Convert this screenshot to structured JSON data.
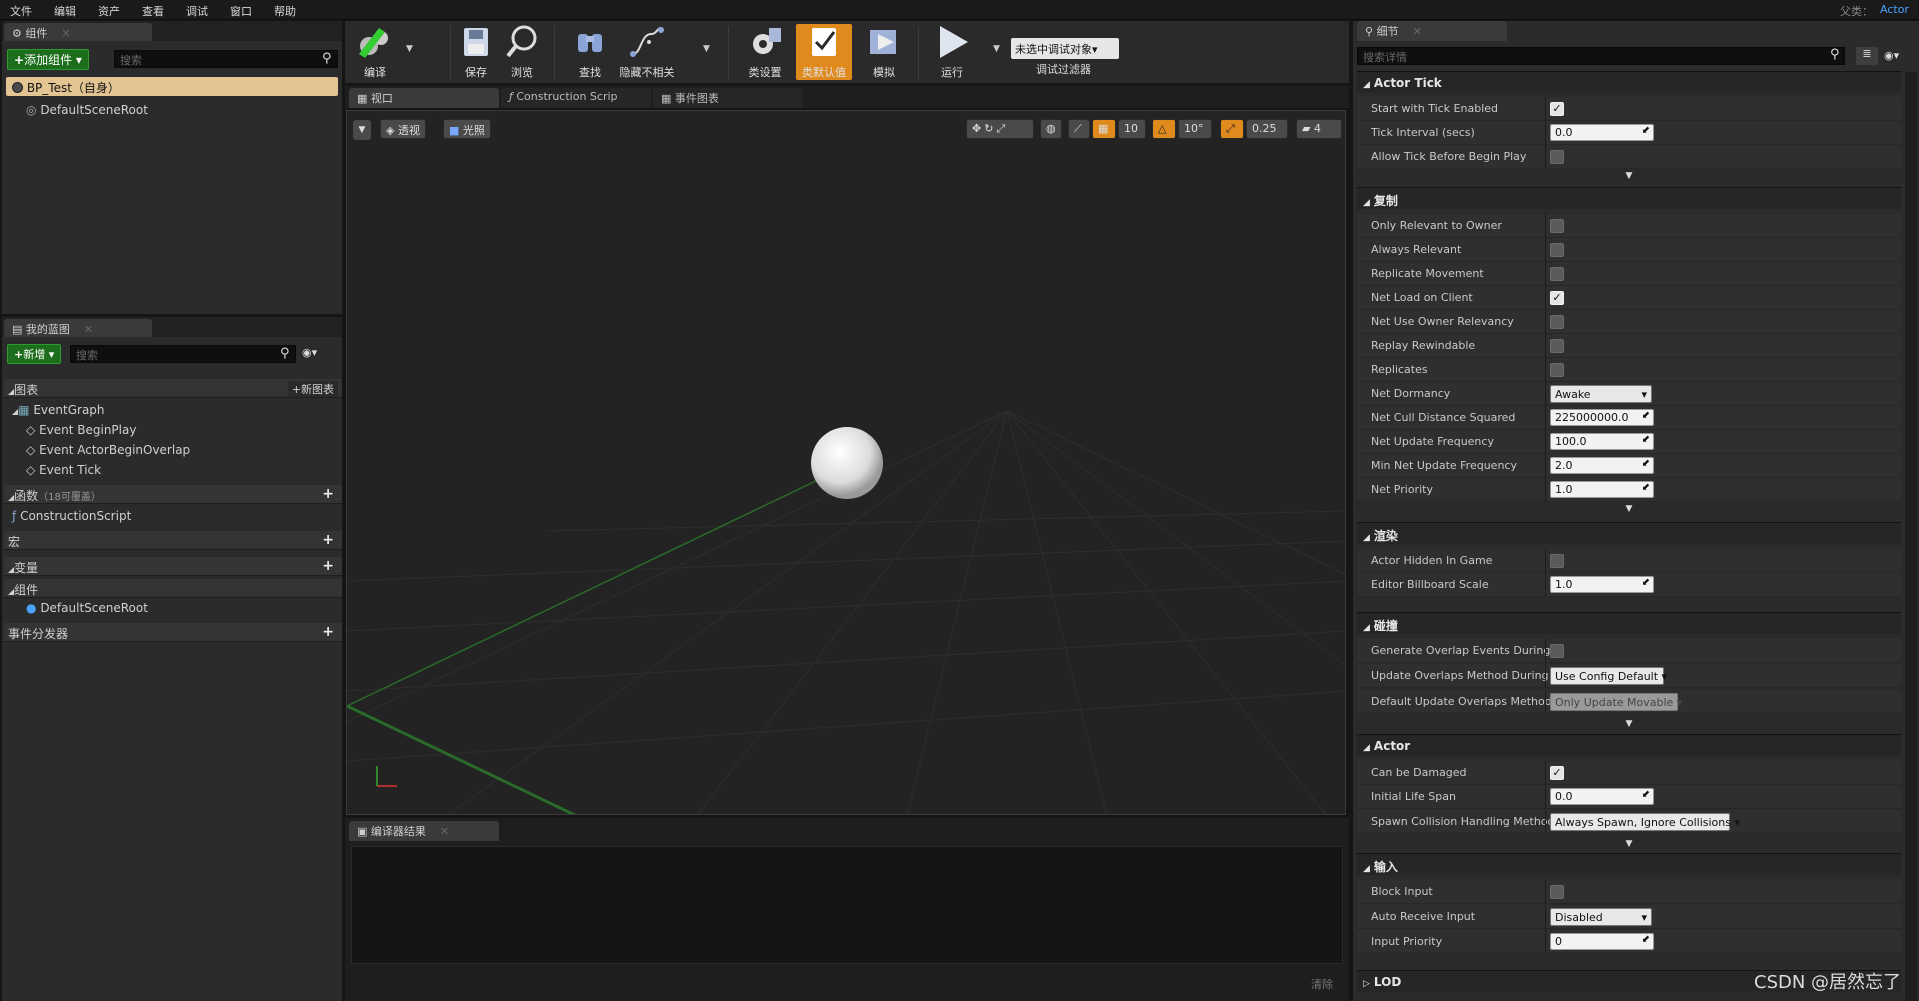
{
  "menu": {
    "file": "文件",
    "edit": "编辑",
    "asset": "资产",
    "view": "查看",
    "debug": "调试",
    "window": "窗口",
    "help": "帮助"
  },
  "parent_class": {
    "label": "父类：",
    "value": "Actor"
  },
  "components_panel": {
    "tab": "组件",
    "add_button": "添加组件",
    "search_placeholder": "搜索",
    "root_item": "BP_Test（自身）",
    "items": [
      "DefaultSceneRoot"
    ]
  },
  "my_blueprint": {
    "tab": "我的蓝图",
    "add_new": "新增",
    "search_placeholder": "搜索",
    "graphs_header": "图表",
    "new_graph": "新图表",
    "event_graph": "EventGraph",
    "events": [
      "Event BeginPlay",
      "Event ActorBeginOverlap",
      "Event Tick"
    ],
    "functions_header": "函数",
    "functions_count": "（18可覆盖）",
    "functions": [
      "ConstructionScript"
    ],
    "macros_header": "宏",
    "variables_header": "变量",
    "components_header": "组件",
    "components": [
      "DefaultSceneRoot"
    ],
    "dispatchers_header": "事件分发器"
  },
  "toolbar": {
    "compile": "编译",
    "save": "保存",
    "browse": "浏览",
    "find": "查找",
    "hide_unrelated": "隐藏不相关",
    "class_settings": "类设置",
    "class_defaults": "类默认值",
    "simulate": "模拟",
    "play": "运行",
    "debug_object": "未选中调试对象",
    "debug_filter": "调试过滤器"
  },
  "editor_tabs": {
    "viewport": "视口",
    "construction_script": "Construction Scrip",
    "event_graph": "事件图表"
  },
  "viewport": {
    "perspective": "透视",
    "lit": "光照",
    "grid_snap": "10",
    "rot_snap": "10°",
    "scale_snap": "0.25",
    "cam_speed": "4"
  },
  "compiler": {
    "tab": "编译器结果",
    "clear": "清除"
  },
  "details": {
    "tab": "细节",
    "search_placeholder": "搜索详情",
    "sections": {
      "actor_tick": "Actor Tick",
      "replication": "复制",
      "rendering": "渲染",
      "collision": "碰撞",
      "actor": "Actor",
      "input": "输入",
      "lod": "LOD"
    },
    "actor_tick": {
      "start_with_tick": "Start with Tick Enabled",
      "start_with_tick_val": true,
      "tick_interval": "Tick Interval (secs)",
      "tick_interval_val": "0.0",
      "allow_tick_before": "Allow Tick Before Begin Play",
      "allow_tick_before_val": false
    },
    "replication": {
      "only_relevant": "Only Relevant to Owner",
      "always_relevant": "Always Relevant",
      "replicate_movement": "Replicate Movement",
      "net_load": "Net Load on Client",
      "net_use_owner": "Net Use Owner Relevancy",
      "replay_rewindable": "Replay Rewindable",
      "replicates": "Replicates",
      "net_dormancy": "Net Dormancy",
      "net_dormancy_val": "Awake",
      "net_cull": "Net Cull Distance Squared",
      "net_cull_val": "225000000.0",
      "net_update": "Net Update Frequency",
      "net_update_val": "100.0",
      "min_net_update": "Min Net Update Frequency",
      "min_net_update_val": "2.0",
      "net_priority": "Net Priority",
      "net_priority_val": "1.0"
    },
    "rendering": {
      "hidden_in_game": "Actor Hidden In Game",
      "billboard_scale": "Editor Billboard Scale",
      "billboard_scale_val": "1.0"
    },
    "collision": {
      "gen_overlap": "Generate Overlap Events During Le",
      "update_overlaps": "Update Overlaps Method During Le",
      "update_overlaps_val": "Use Config Default",
      "default_update": "Default Update Overlaps Method Du",
      "default_update_val": "Only Update Movable"
    },
    "actor": {
      "can_be_damaged": "Can be Damaged",
      "initial_life": "Initial Life Span",
      "initial_life_val": "0.0",
      "spawn_collision": "Spawn Collision Handling Method",
      "spawn_collision_val": "Always Spawn, Ignore Collisions"
    },
    "input": {
      "block_input": "Block Input",
      "auto_receive": "Auto Receive Input",
      "auto_receive_val": "Disabled",
      "input_priority": "Input Priority",
      "input_priority_val": "0"
    }
  },
  "watermark": "CSDN @居然忘了",
  "colors": {
    "accent_orange": "#e08a1e",
    "add_green": "#1c6e1c",
    "link_blue": "#4aa3ff"
  }
}
